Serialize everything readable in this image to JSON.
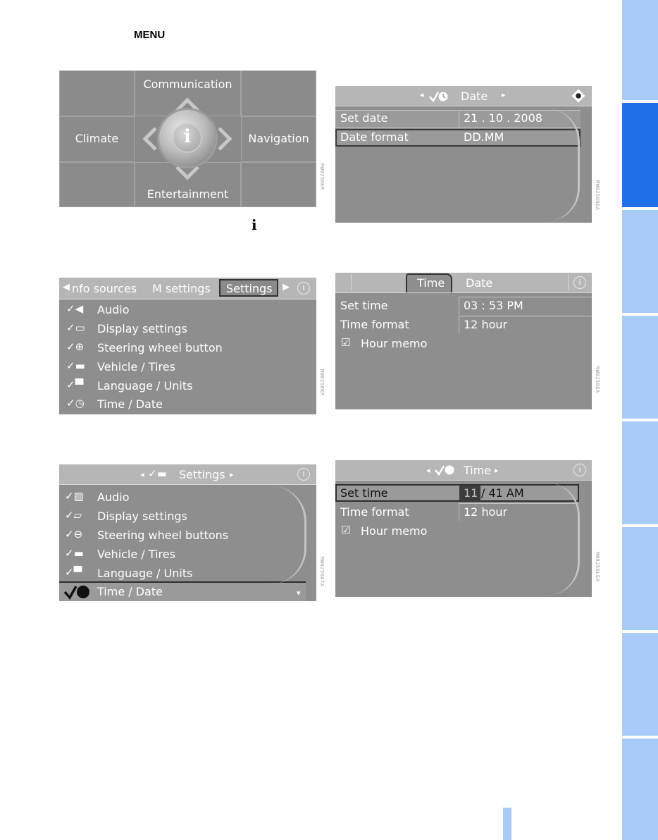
{
  "header": {
    "menu_label": "MENU",
    "info_symbol": "i"
  },
  "main_menu": {
    "top": "Communication",
    "left": "Climate",
    "right": "Navigation",
    "bottom": "Entertainment",
    "center_icon": "info-button-icon"
  },
  "date_screen": {
    "title": "Date",
    "rows": [
      {
        "label": "Set date",
        "value": "21 . 10 . 2008"
      },
      {
        "label": "Date format",
        "value": "DD.MM"
      }
    ]
  },
  "settings_tabs_screen": {
    "tabs": [
      "nfo sources",
      "M settings",
      "Settings"
    ],
    "active_tab": "Settings",
    "items": [
      "Audio",
      "Display settings",
      "Steering wheel button",
      "Vehicle / Tires",
      "Language / Units",
      "Time / Date"
    ]
  },
  "time_tabs_screen": {
    "tabs": [
      "Time",
      "Date"
    ],
    "active_tab": "Time",
    "rows": [
      {
        "label": "Set time",
        "value": "03 : 53 PM"
      },
      {
        "label": "Time format",
        "value": "12 hour"
      }
    ],
    "checkbox_label": "Hour memo"
  },
  "settings_list_screen": {
    "title": "Settings",
    "items": [
      "Audio",
      "Display settings",
      "Steering wheel buttons",
      "Vehicle / Tires",
      "Language / Units",
      "Time / Date"
    ],
    "selected": "Time / Date"
  },
  "time_edit_screen": {
    "title": "Time",
    "rows": [
      {
        "label": "Set time",
        "value_highlight": "11",
        "value_rest": "/ 41 AM"
      },
      {
        "label": "Time format",
        "value": "12 hour"
      }
    ],
    "checkbox_label": "Hour memo"
  },
  "image_codes": [
    "MW0250KR",
    "MW0250DEA",
    "MW0250KR",
    "MW0250EA",
    "MW0250ATA",
    "MW0250LEA"
  ],
  "colors": {
    "tab_light": "#a8ccf7",
    "tab_active": "#1f6fe8",
    "screen_bg": "#8e8e8e"
  }
}
